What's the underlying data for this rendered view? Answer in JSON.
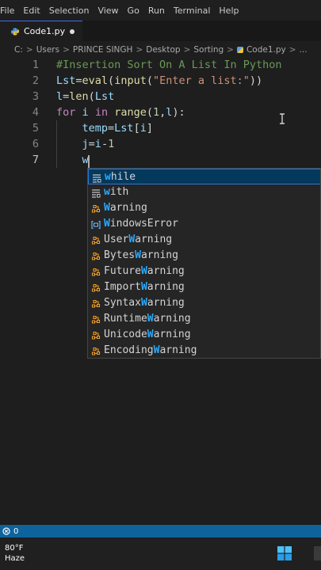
{
  "menu": [
    "File",
    "Edit",
    "Selection",
    "View",
    "Go",
    "Run",
    "Terminal",
    "Help"
  ],
  "tab": {
    "filename": "Code1.py",
    "icon": "python-file-icon",
    "unsaved": true
  },
  "breadcrumb": {
    "parts": [
      "C:",
      "Users",
      "PRINCE SINGH",
      "Desktop",
      "Sorting",
      "Code1.py",
      "..."
    ],
    "separator": ">"
  },
  "editor": {
    "line_numbers": [
      "1",
      "2",
      "3",
      "4",
      "5",
      "6",
      "7"
    ],
    "current_line": 7,
    "lines": [
      [
        {
          "t": "#Insertion Sort On A List In Python",
          "k": "comment"
        }
      ],
      [
        {
          "t": "Lst",
          "k": "var"
        },
        {
          "t": "=",
          "k": "op"
        },
        {
          "t": "eval",
          "k": "fn"
        },
        {
          "t": "(",
          "k": "op"
        },
        {
          "t": "input",
          "k": "fn"
        },
        {
          "t": "(",
          "k": "op"
        },
        {
          "t": "\"Enter a list:\"",
          "k": "str"
        },
        {
          "t": "))",
          "k": "op"
        }
      ],
      [
        {
          "t": "l",
          "k": "var"
        },
        {
          "t": "=",
          "k": "op"
        },
        {
          "t": "len",
          "k": "fn"
        },
        {
          "t": "(",
          "k": "op"
        },
        {
          "t": "Lst",
          "k": "var"
        }
      ],
      [
        {
          "t": "for",
          "k": "kw"
        },
        {
          "t": " ",
          "k": "op"
        },
        {
          "t": "i",
          "k": "var"
        },
        {
          "t": " ",
          "k": "op"
        },
        {
          "t": "in",
          "k": "kw"
        },
        {
          "t": " ",
          "k": "op"
        },
        {
          "t": "range",
          "k": "fn"
        },
        {
          "t": "(",
          "k": "op"
        },
        {
          "t": "1",
          "k": "num"
        },
        {
          "t": ",",
          "k": "op"
        },
        {
          "t": "l",
          "k": "var"
        },
        {
          "t": "):",
          "k": "op"
        }
      ],
      [
        {
          "t": "    ",
          "k": "op"
        },
        {
          "t": "temp",
          "k": "var"
        },
        {
          "t": "=",
          "k": "op"
        },
        {
          "t": "Lst",
          "k": "var"
        },
        {
          "t": "[",
          "k": "op"
        },
        {
          "t": "i",
          "k": "var"
        },
        {
          "t": "]",
          "k": "op"
        }
      ],
      [
        {
          "t": "    ",
          "k": "op"
        },
        {
          "t": "j",
          "k": "var"
        },
        {
          "t": "=",
          "k": "op"
        },
        {
          "t": "i",
          "k": "var"
        },
        {
          "t": "-",
          "k": "op"
        },
        {
          "t": "1",
          "k": "num"
        }
      ],
      [
        {
          "t": "    ",
          "k": "op"
        },
        {
          "t": "w",
          "k": "var"
        }
      ]
    ]
  },
  "suggestions": {
    "typed": "w",
    "items": [
      {
        "label": "while",
        "match": "w",
        "icon": "snippet-icon",
        "selected": true
      },
      {
        "label": "with",
        "match": "w",
        "icon": "snippet-icon",
        "selected": false
      },
      {
        "label": "Warning",
        "match": "W",
        "icon": "class-icon",
        "selected": false
      },
      {
        "label": "WindowsError",
        "match": "W",
        "icon": "variable-icon",
        "selected": false
      },
      {
        "label": "UserWarning",
        "match": "W",
        "icon": "class-icon",
        "selected": false
      },
      {
        "label": "BytesWarning",
        "match": "W",
        "icon": "class-icon",
        "selected": false
      },
      {
        "label": "FutureWarning",
        "match": "W",
        "icon": "class-icon",
        "selected": false
      },
      {
        "label": "ImportWarning",
        "match": "W",
        "icon": "class-icon",
        "selected": false
      },
      {
        "label": "SyntaxWarning",
        "match": "W",
        "icon": "class-icon",
        "selected": false
      },
      {
        "label": "RuntimeWarning",
        "match": "W",
        "icon": "class-icon",
        "selected": false
      },
      {
        "label": "UnicodeWarning",
        "match": "W",
        "icon": "class-icon",
        "selected": false
      },
      {
        "label": "EncodingWarning",
        "match": "W",
        "icon": "class-icon",
        "selected": false
      }
    ]
  },
  "statusbar": {
    "problems": "0",
    "icon": "error-icon"
  },
  "taskbar": {
    "temperature": "80°F",
    "condition": "Haze",
    "start_icon": "windows-start-icon"
  },
  "colors": {
    "accent": "#0e639c",
    "match_highlight": "#2aaaff",
    "selection_bg": "#04395e",
    "comment": "#6a9955",
    "keyword": "#c586c0",
    "variable": "#9cdcfe",
    "function": "#dcdcaa",
    "string": "#ce9178"
  }
}
